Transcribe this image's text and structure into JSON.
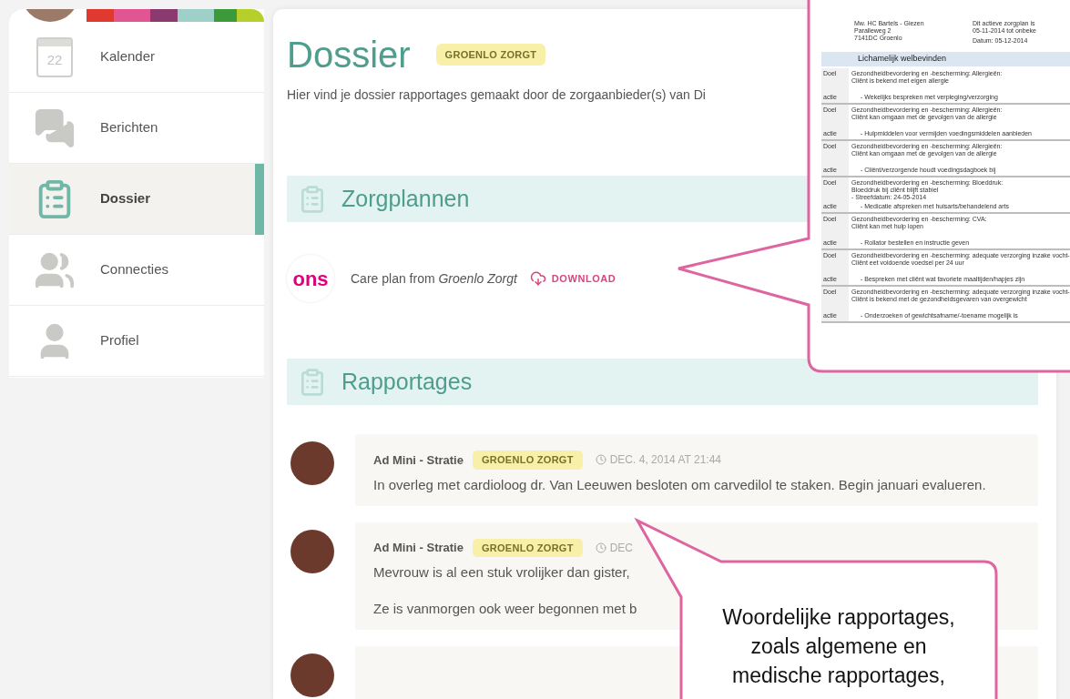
{
  "sidebar": {
    "items": [
      {
        "label": "Kalender",
        "selected": false,
        "icon_label": "22"
      },
      {
        "label": "Berichten",
        "selected": false
      },
      {
        "label": "Dossier",
        "selected": true
      },
      {
        "label": "Connecties",
        "selected": false
      },
      {
        "label": "Profiel",
        "selected": false
      }
    ]
  },
  "main": {
    "title": "Dossier",
    "badge": "GROENLO ZORGT",
    "description": "Hier vind je dossier rapportages gemaakt door de zorgaanbieder(s) van Di",
    "care_plans": {
      "heading": "Zorgplannen",
      "items": [
        {
          "logo": "ons",
          "text": "Care plan from *Groenlo Zorgt*",
          "download": "DOWNLOAD"
        }
      ]
    },
    "reports": {
      "heading": "Rapportages",
      "items": [
        {
          "author": "Ad Mini - Stratie",
          "org": "GROENLO ZORGT",
          "date": "DEC. 4, 2014 AT 21:44",
          "paragraphs": [
            "In overleg met cardioloog dr. Van Leeuwen besloten om carvedilol te staken. Begin januari evalueren."
          ]
        },
        {
          "author": "Ad Mini - Stratie",
          "org": "GROENLO ZORGT",
          "date": "DEC",
          "paragraphs": [
            "Mevrouw is al een stuk vrolijker dan gister,",
            "Ze is vanmorgen ook weer begonnen met b"
          ]
        }
      ]
    }
  },
  "callouts": [
    {
      "kind": "document",
      "address": [
        "Mw. HC Bartels - Giezen",
        "Paralleweg 2",
        "7141DC Groenlo"
      ],
      "plan_info": [
        "Dit actieve zorgplan is",
        "05-11-2014 tot onbeke"
      ],
      "date": "Datum: 05-12-2014",
      "section": "Lichamelijk welbevinden",
      "rows": [
        {
          "goal_label": "Doel",
          "goal": [
            "Gezondheidbevordering en -bescherming: Allergieën:",
            "Cliënt is bekend met eigen allergie"
          ],
          "action_label": "actie",
          "action": "- Wekelijks bespreken met verpleging/verzorging"
        },
        {
          "goal_label": "Doel",
          "goal": [
            "Gezondheidbevordering en -bescherming: Allergieën:",
            "Cliënt kan omgaan met de gevolgen van de allergie"
          ],
          "action_label": "actie",
          "action": "- Hulpmiddelen voor vermijden voedingsmiddelen aanbieden"
        },
        {
          "goal_label": "Doel",
          "goal": [
            "Gezondheidbevordering en -bescherming: Allergieën:",
            "Cliënt kan omgaan met de gevolgen van de allergie"
          ],
          "action_label": "actie",
          "action": "- Cliënt/verzorgende houdt voedingsdagboek bij"
        },
        {
          "goal_label": "Doel",
          "goal": [
            "Gezondheidbevordering en -bescherming: Bloeddruk:",
            "Bloeddruk bij cliënt blijft stabiel",
            " - Streefdatum: 24-05-2014"
          ],
          "action_label": "actie",
          "action": "- Medicatie afspreken met huisarts/behandelend arts"
        },
        {
          "goal_label": "Doel",
          "goal": [
            "Gezondheidbevordering en -bescherming: CVA:",
            "Cliënt kan met hulp lopen"
          ],
          "action_label": "actie",
          "action": "- Rollator bestellen en instructie geven"
        },
        {
          "goal_label": "Doel",
          "goal": [
            "Gezondheidbevordering en -bescherming: adequate verzorging inzake vocht-",
            "Cliënt eet voldoende voedsel per 24 uur"
          ],
          "action_label": "actie",
          "action": "- Bespreken met cliënt wat favoriete maaltijden/hapjes zijn"
        },
        {
          "goal_label": "Doel",
          "goal": [
            "Gezondheidbevordering en -bescherming: adequate verzorging inzake vocht-",
            "Cliënt is bekend met de gezondheidsgevaren van overgewicht"
          ],
          "action_label": "actie",
          "action": "- Onderzoeken of gewichtsafname/-toename mogelijk is"
        }
      ]
    },
    {
      "kind": "text",
      "text": "Woordelijke rapportages, zoals algemene en medische rapportages,"
    }
  ]
}
